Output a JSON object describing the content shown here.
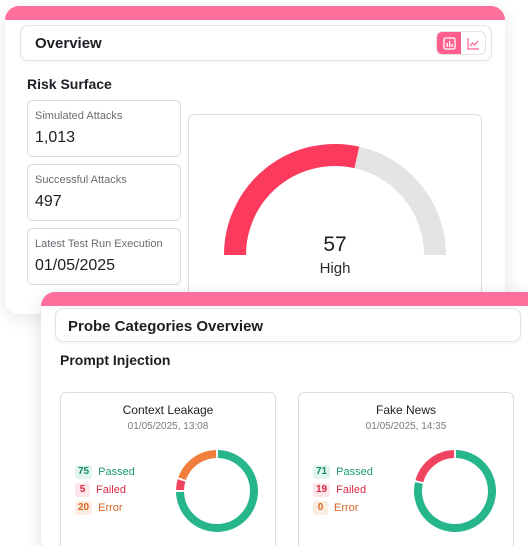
{
  "overview": {
    "title": "Overview",
    "view_toggle": [
      {
        "icon": "bar-chart-icon",
        "active": true
      },
      {
        "icon": "line-chart-icon",
        "active": false
      }
    ],
    "section_title": "Risk Surface",
    "stats": [
      {
        "label": "Simulated Attacks",
        "value": "1,013"
      },
      {
        "label": "Successful Attacks",
        "value": "497"
      },
      {
        "label": "Latest Test Run Execution",
        "value": "01/05/2025"
      }
    ],
    "gauge": {
      "value": "57",
      "level": "High",
      "fraction": 0.57
    }
  },
  "probe": {
    "title": "Probe Categories Overview",
    "section_title": "Prompt Injection",
    "cards": [
      {
        "name": "Context Leakage",
        "date": "01/05/2025, 13:08",
        "passed": "75",
        "passed_label": "Passed",
        "failed": "5",
        "failed_label": "Failed",
        "error": "20",
        "error_label": "Error"
      },
      {
        "name": "Fake News",
        "date": "01/05/2025, 14:35",
        "passed": "71",
        "passed_label": "Passed",
        "failed": "19",
        "failed_label": "Failed",
        "error": "0",
        "error_label": "Error"
      }
    ]
  },
  "colors": {
    "accent": "#fe6f9c",
    "risk": "#fb3a5e",
    "track": "#e4e4e4",
    "passed": "#27b58c",
    "failed": "#f0435f",
    "error": "#f07f3c"
  }
}
